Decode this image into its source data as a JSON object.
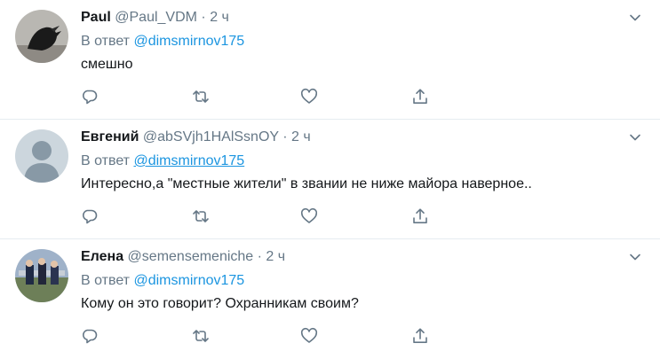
{
  "reply_prefix": "В ответ",
  "tweets": [
    {
      "name": "Paul",
      "handle": "@Paul_VDM",
      "sep": "·",
      "time": "2 ч",
      "reply_to": "@dimsmirnov175",
      "text": "смешно"
    },
    {
      "name": "Евгений",
      "handle": "@abSVjh1HAlSsnOY",
      "sep": "·",
      "time": "2 ч",
      "reply_to": "@dimsmirnov175",
      "text": "Интересно,а \"местные жители\" в звании не ниже майора наверное.."
    },
    {
      "name": "Елена",
      "handle": "@semensemeniche",
      "sep": "·",
      "time": "2 ч",
      "reply_to": "@dimsmirnov175",
      "text": "Кому он это говорит? Охранникам своим?"
    }
  ],
  "icons": {
    "reply": "reply-icon",
    "retweet": "retweet-icon",
    "like": "heart-icon",
    "share": "share-icon",
    "more": "chevron-down-icon"
  },
  "colors": {
    "link": "#1b95e0",
    "muted": "#657786",
    "text": "#14171a",
    "divider": "#e6ecf0"
  }
}
